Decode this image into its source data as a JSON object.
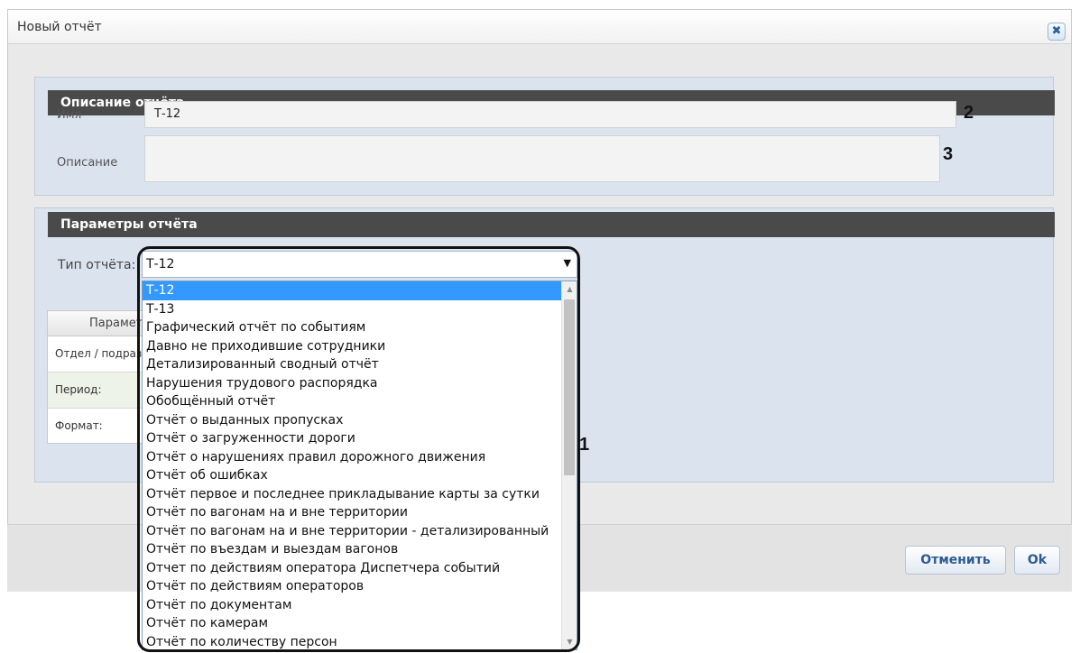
{
  "dialog": {
    "title": "Новый отчёт",
    "close_icon": "close-icon"
  },
  "description_section": {
    "header": "Описание отчёта",
    "name_label": "Имя",
    "name_value": "Т-12",
    "description_label": "Описание",
    "description_value": ""
  },
  "params_section": {
    "header": "Параметры отчёта",
    "report_type_label": "Тип отчёта:",
    "report_type_value": "Т-12"
  },
  "params_table": {
    "header": "Параметры",
    "rows": [
      "Отдел / подразделение",
      "Период:",
      "Формат:"
    ]
  },
  "dropdown": {
    "selected": "Т-12",
    "options": [
      "Т-12",
      "Т-13",
      "Графический отчёт по событиям",
      "Давно не приходившие сотрудники",
      "Детализированный сводный отчёт",
      "Нарушения трудового распорядка",
      "Обобщённый отчёт",
      "Отчёт о выданных пропусках",
      "Отчёт о загруженности дороги",
      "Отчёт о нарушениях правил дорожного движения",
      "Отчёт об ошибках",
      "Отчёт первое и последнее прикладывание карты за сутки",
      "Отчёт по вагонам на и вне территории",
      "Отчёт по вагонам на и вне территории - детализированный",
      "Отчёт по въездам и выездам вагонов",
      "Отчет по действиям оператора Диспетчера событий",
      "Отчёт по действиям операторов",
      "Отчёт по документам",
      "Отчёт по камерам",
      "Отчёт по количеству персон"
    ]
  },
  "annotations": {
    "marker_1": "1",
    "marker_2": "2",
    "marker_3": "3"
  },
  "footer": {
    "cancel_label": "Отменить",
    "ok_label": "Ok"
  },
  "colors": {
    "section_header_bg": "#4a4a4a",
    "section_bg": "#dbe4ee",
    "selected_option_bg": "#3399ff",
    "button_text": "#2b5c93"
  }
}
